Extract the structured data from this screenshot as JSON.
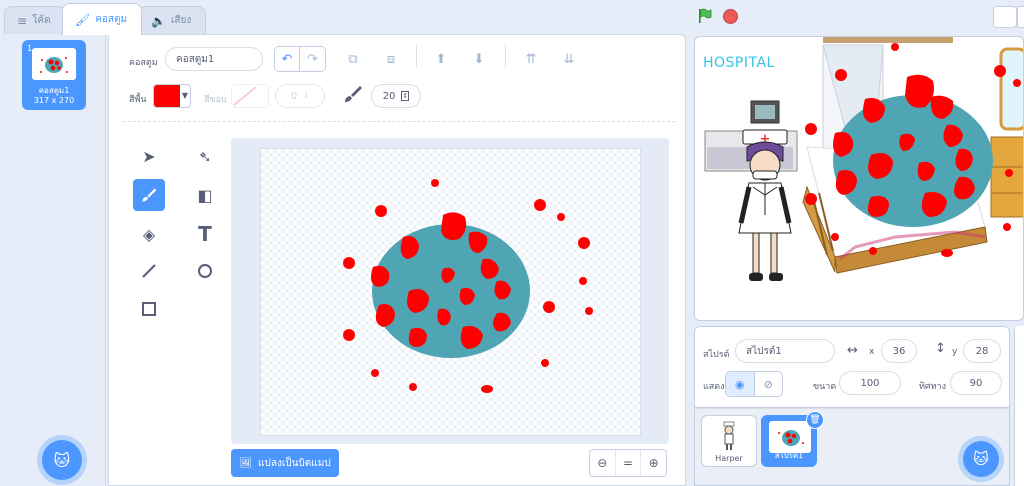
{
  "tabs": [
    {
      "label": "โค้ด",
      "icon": "code-icon"
    },
    {
      "label": "คอสตูม",
      "icon": "brush-icon"
    },
    {
      "label": "เสียง",
      "icon": "speaker-icon"
    }
  ],
  "costume_list": [
    {
      "number": "1",
      "name": "คอสตูม1",
      "size": "317 x 270"
    }
  ],
  "editor": {
    "costume_label": "คอสตูม",
    "costume_name": "คอสตูม1",
    "fill_label": "สีพื้น",
    "fill_color": "#ff0000",
    "outline_label": "สีขอบ",
    "outline_width": "0",
    "brush_size": "20",
    "convert_button": "แปลงเป็นบิตแมป"
  },
  "stage": {
    "hospital_text": "HOSPITAL"
  },
  "sprite_info": {
    "sprite_label": "สไปรต์",
    "sprite_name": "สไปรต์1",
    "x_label": "x",
    "x_value": "36",
    "y_label": "y",
    "y_value": "28",
    "show_label": "แสดง",
    "size_label": "ขนาด",
    "size_value": "100",
    "direction_label": "ทิศทาง",
    "direction_value": "90"
  },
  "sprites": [
    {
      "name": "Harper"
    },
    {
      "name": "สไปรต์1"
    }
  ],
  "colors": {
    "accent": "#4c97ff",
    "blob": "#4fa5b3",
    "dot": "#ff0000",
    "stop": "#ec5959"
  }
}
